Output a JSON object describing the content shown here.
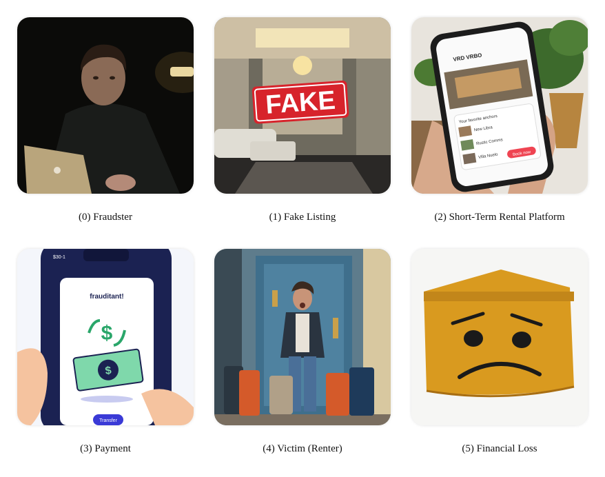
{
  "panels": [
    {
      "caption": "(0) Fraudster",
      "icon": "hooded-man-laptop-photo"
    },
    {
      "caption": "(1) Fake Listing",
      "icon": "luxury-room-fake-stamp-photo",
      "stamp_text": "FAKE"
    },
    {
      "caption": "(2) Short-Term Rental Platform",
      "icon": "hand-phone-rental-app-photo",
      "app": {
        "brand": "VRD VRBO",
        "lines": [
          "Your favorite anchors",
          "New Libra",
          "Rustic Comms",
          "Villa Nuelo"
        ],
        "button": "Book now"
      }
    },
    {
      "caption": "(3) Payment",
      "icon": "phone-money-transfer-illustration",
      "phone": {
        "time": "$30-1",
        "title": "frauditant!",
        "button": "Transfer"
      }
    },
    {
      "caption": "(4) Victim (Renter)",
      "icon": "shocked-man-luggage-door-photo"
    },
    {
      "caption": "(5) Financial Loss",
      "icon": "sad-wallet-photo"
    }
  ]
}
